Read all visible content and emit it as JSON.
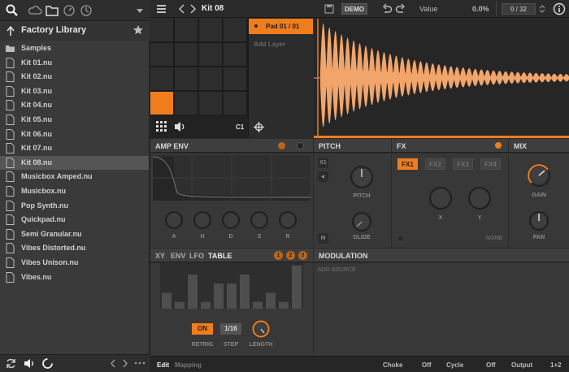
{
  "sidebar": {
    "library_title": "Factory Library",
    "files": [
      {
        "label": "Samples",
        "type": "folder"
      },
      {
        "label": "Kit 01.nu",
        "type": "file"
      },
      {
        "label": "Kit 02.nu",
        "type": "file"
      },
      {
        "label": "Kit 03.nu",
        "type": "file"
      },
      {
        "label": "Kit 04.nu",
        "type": "file"
      },
      {
        "label": "Kit 05.nu",
        "type": "file"
      },
      {
        "label": "Kit 06.nu",
        "type": "file"
      },
      {
        "label": "Kit 07.nu",
        "type": "file"
      },
      {
        "label": "Kit 08.nu",
        "type": "file",
        "selected": true
      },
      {
        "label": "Musicbox Amped.nu",
        "type": "file"
      },
      {
        "label": "Musicbox.nu",
        "type": "file"
      },
      {
        "label": "Pop Synth.nu",
        "type": "file"
      },
      {
        "label": "Quickpad.nu",
        "type": "file"
      },
      {
        "label": "Semi Granular.nu",
        "type": "file"
      },
      {
        "label": "Vibes Distorted.nu",
        "type": "file"
      },
      {
        "label": "Vibes Unison.nu",
        "type": "file"
      },
      {
        "label": "Vibes.nu",
        "type": "file"
      }
    ]
  },
  "topbar": {
    "title": "Kit 08",
    "demo_label": "DEMO",
    "value_label": "Value",
    "value_reading": "0.0%",
    "counter": "0 / 32"
  },
  "pads": {
    "note": "C1",
    "active_pad": "Pad 01 / 01",
    "add_layer": "Add Layer"
  },
  "amp_env": {
    "title": "AMP ENV",
    "knobs": [
      "A",
      "H",
      "D",
      "S",
      "R"
    ]
  },
  "pitch": {
    "title": "PITCH",
    "btn_x1": "X1",
    "btn_m": "M",
    "pitch_label": "PITCH",
    "glide_label": "GLIDE"
  },
  "fx": {
    "title": "FX",
    "slots": [
      "FX1",
      "FX2",
      "FX3",
      "FX4"
    ],
    "x_label": "X",
    "y_label": "Y",
    "none_label": "NONE"
  },
  "mix": {
    "title": "MIX",
    "gain_label": "GAIN",
    "pan_label": "PAN"
  },
  "lfo": {
    "tabs": [
      "XY",
      "ENV",
      "LFO",
      "TABLE"
    ],
    "active_tab": "TABLE",
    "badges": [
      "1",
      "2",
      "3"
    ],
    "step_values": [
      0.35,
      0.15,
      0.75,
      0.15,
      0.55,
      0.55,
      0.75,
      0.15,
      0.35,
      0.15,
      0.95
    ],
    "on_label": "ON",
    "step_value": "1/16",
    "retrig_label": "RETRIG",
    "step_label": "STEP",
    "length_label": "LENGTH"
  },
  "modulation": {
    "title": "MODULATION",
    "add_source": "ADD SOURCE"
  },
  "bottombar": {
    "edit": "Edit",
    "mapping": "Mapping",
    "choke_label": "Choke",
    "choke_value": "Off",
    "cycle_label": "Cycle",
    "cycle_value": "Off",
    "output_label": "Output",
    "output_value": "1+2"
  },
  "colors": {
    "accent": "#f07d1d",
    "panel": "#383838",
    "background": "#2b2b2b"
  }
}
